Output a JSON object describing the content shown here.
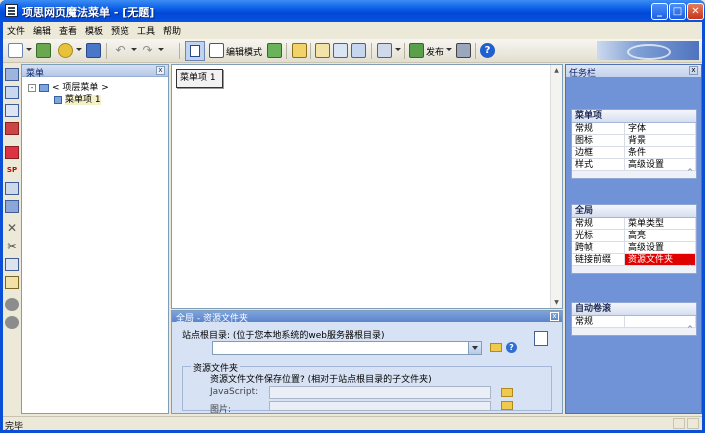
{
  "window": {
    "title": "项思网页魔法菜单 - [无题]",
    "minimize": "_",
    "maximize": "□",
    "close": "✕"
  },
  "menubar": [
    "文件",
    "编辑",
    "查看",
    "模板",
    "预览",
    "工具",
    "帮助"
  ],
  "toolbar": {
    "edit_mode_label": "编辑模式",
    "publish_label": "发布"
  },
  "tree_panel": {
    "title": "菜单",
    "close": "x",
    "root_label": "< 项层菜单 >",
    "expander": "-",
    "child_label": "菜单项 1"
  },
  "canvas": {
    "menu_item": "菜单项 1",
    "scroll_up": "▲",
    "scroll_down": "▼"
  },
  "global_panel": {
    "title": "全局 - 资源文件夹",
    "close": "x",
    "root_label": "站点根目录: (位于您本地系统的web服务器根目录)",
    "root_value": "",
    "help": "?",
    "group_legend": "资源文件夹",
    "group_question": "资源文件文件保存位置? (相对于站点根目录的子文件夹)",
    "javascript_label": "JavaScript:",
    "images_label": "图片:",
    "javascript_value": "",
    "images_value": ""
  },
  "taskpane": {
    "title": "任务栏",
    "close": "x",
    "sections": [
      {
        "title": "菜单项",
        "cells": [
          "常规",
          "字体",
          "图标",
          "背景",
          "边框",
          "条件",
          "样式",
          "高级设置"
        ],
        "highlight": -1
      },
      {
        "title": "全局",
        "cells": [
          "常规",
          "菜单类型",
          "光标",
          "高亮",
          "跨帧",
          "高级设置",
          "链接前缀",
          "资源文件夹"
        ],
        "highlight": 7
      },
      {
        "title": "自动卷滚",
        "cells": [
          "常规",
          ""
        ],
        "highlight": -1
      }
    ]
  },
  "statusbar": {
    "text": "完毕"
  },
  "colors": {
    "titlebar": "#0a5ee8",
    "highlight": "#e00000",
    "taskpane_bg": "#6f93d6",
    "panel_bg": "#d7e2f5"
  }
}
